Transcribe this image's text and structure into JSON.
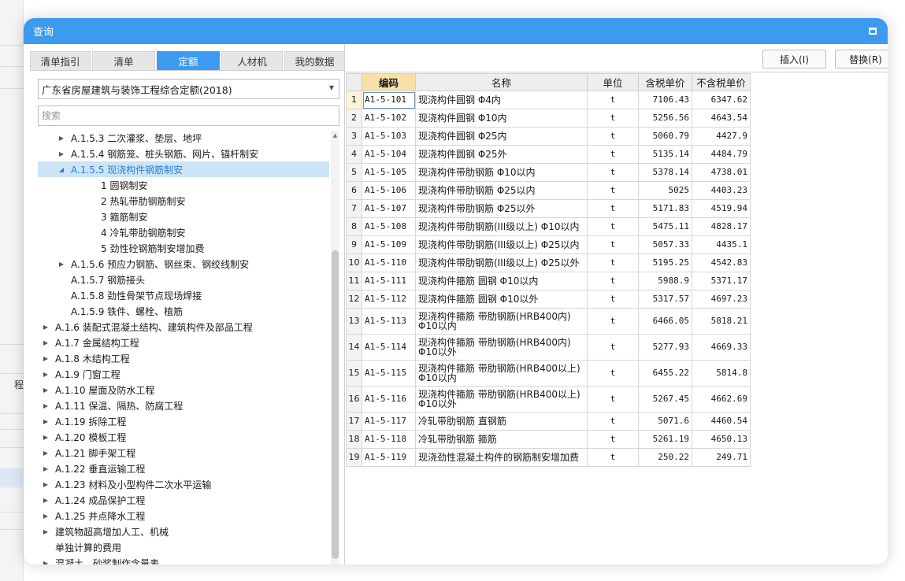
{
  "dialog": {
    "title": "查询"
  },
  "tabs": [
    {
      "label": "清单指引"
    },
    {
      "label": "清单"
    },
    {
      "label": "定额"
    },
    {
      "label": "人材机"
    },
    {
      "label": "我的数据"
    }
  ],
  "library": {
    "selected": "广东省房屋建筑与装饰工程综合定额(2018)"
  },
  "search": {
    "placeholder": "搜索"
  },
  "tree": [
    {
      "label": "A.1.5.3 二次灌浆、垫层、地坪",
      "arrow": "▶"
    },
    {
      "label": "A.1.5.4 钢筋笼、桩头钢筋、网片、锚杆制安",
      "arrow": "▶"
    },
    {
      "label": "A.1.5.5 现浇构件钢筋制安",
      "arrow": "◢",
      "selected": true
    },
    {
      "label": "1 圆钢制安",
      "arrow": ""
    },
    {
      "label": "2 热轧带肋钢筋制安",
      "arrow": ""
    },
    {
      "label": "3 箍筋制安",
      "arrow": ""
    },
    {
      "label": "4 冷轧带肋钢筋制安",
      "arrow": ""
    },
    {
      "label": "5 劲性砼钢筋制安增加费",
      "arrow": ""
    },
    {
      "label": "A.1.5.6 预应力钢筋、钢丝束、钢绞线制安",
      "arrow": "▶"
    },
    {
      "label": "A.1.5.7 钢筋接头",
      "arrow": ""
    },
    {
      "label": "A.1.5.8 劲性骨架节点现场焊接",
      "arrow": ""
    },
    {
      "label": "A.1.5.9 铁件、螺栓、植筋",
      "arrow": ""
    },
    {
      "label": "A.1.6 装配式混凝土结构、建筑构件及部品工程",
      "arrow": "▶"
    },
    {
      "label": "A.1.7 金属结构工程",
      "arrow": "▶"
    },
    {
      "label": "A.1.8 木结构工程",
      "arrow": "▶"
    },
    {
      "label": "A.1.9 门窗工程",
      "arrow": "▶"
    },
    {
      "label": "A.1.10 屋面及防水工程",
      "arrow": "▶"
    },
    {
      "label": "A.1.11 保温、隔热、防腐工程",
      "arrow": "▶"
    },
    {
      "label": "A.1.19 拆除工程",
      "arrow": "▶"
    },
    {
      "label": "A.1.20 模板工程",
      "arrow": "▶"
    },
    {
      "label": "A.1.21 脚手架工程",
      "arrow": "▶"
    },
    {
      "label": "A.1.22 垂直运输工程",
      "arrow": "▶"
    },
    {
      "label": "A.1.23 材料及小型构件二次水平运输",
      "arrow": "▶"
    },
    {
      "label": "A.1.24 成品保护工程",
      "arrow": "▶"
    },
    {
      "label": "A.1.25 井点降水工程",
      "arrow": "▶"
    },
    {
      "label": "建筑物超高增加人工、机械",
      "arrow": "▶"
    },
    {
      "label": "单独计算的费用",
      "arrow": ""
    },
    {
      "label": "混凝土、砂浆制作含量表",
      "arrow": "▶"
    }
  ],
  "toolbar": {
    "insert_label": "插入(I)",
    "replace_label": "替换(R)"
  },
  "grid": {
    "columns": [
      "编码",
      "名称",
      "单位",
      "含税单价",
      "不含税单价"
    ],
    "rows": [
      {
        "no": "1",
        "code": "A1-5-101",
        "name": "现浇构件圆钢 Φ4内",
        "unit": "t",
        "tax_price": "7106.43",
        "notax_price": "6347.62"
      },
      {
        "no": "2",
        "code": "A1-5-102",
        "name": "现浇构件圆钢 Φ10内",
        "unit": "t",
        "tax_price": "5256.56",
        "notax_price": "4643.54"
      },
      {
        "no": "3",
        "code": "A1-5-103",
        "name": "现浇构件圆钢 Φ25内",
        "unit": "t",
        "tax_price": "5060.79",
        "notax_price": "4427.9"
      },
      {
        "no": "4",
        "code": "A1-5-104",
        "name": "现浇构件圆钢 Φ25外",
        "unit": "t",
        "tax_price": "5135.14",
        "notax_price": "4484.79"
      },
      {
        "no": "5",
        "code": "A1-5-105",
        "name": "现浇构件带肋钢筋 Φ10以内",
        "unit": "t",
        "tax_price": "5378.14",
        "notax_price": "4738.01"
      },
      {
        "no": "6",
        "code": "A1-5-106",
        "name": "现浇构件带肋钢筋 Φ25以内",
        "unit": "t",
        "tax_price": "5025",
        "notax_price": "4403.23"
      },
      {
        "no": "7",
        "code": "A1-5-107",
        "name": "现浇构件带肋钢筋 Φ25以外",
        "unit": "t",
        "tax_price": "5171.83",
        "notax_price": "4519.94"
      },
      {
        "no": "8",
        "code": "A1-5-108",
        "name": "现浇构件带肋钢筋(III级以上) Φ10以内",
        "unit": "t",
        "tax_price": "5475.11",
        "notax_price": "4828.17"
      },
      {
        "no": "9",
        "code": "A1-5-109",
        "name": "现浇构件带肋钢筋(III级以上) Φ25以内",
        "unit": "t",
        "tax_price": "5057.33",
        "notax_price": "4435.1"
      },
      {
        "no": "10",
        "code": "A1-5-110",
        "name": "现浇构件带肋钢筋(III级以上) Φ25以外",
        "unit": "t",
        "tax_price": "5195.25",
        "notax_price": "4542.83"
      },
      {
        "no": "11",
        "code": "A1-5-111",
        "name": "现浇构件箍筋 圆钢 Φ10以内",
        "unit": "t",
        "tax_price": "5988.9",
        "notax_price": "5371.17"
      },
      {
        "no": "12",
        "code": "A1-5-112",
        "name": "现浇构件箍筋 圆钢 Φ10以外",
        "unit": "t",
        "tax_price": "5317.57",
        "notax_price": "4697.23"
      },
      {
        "no": "13",
        "code": "A1-5-113",
        "name": "现浇构件箍筋 带肋钢筋(HRB400内) Φ10以内",
        "unit": "t",
        "tax_price": "6466.05",
        "notax_price": "5818.21",
        "tall": true
      },
      {
        "no": "14",
        "code": "A1-5-114",
        "name": "现浇构件箍筋 带肋钢筋(HRB400内) Φ10以外",
        "unit": "t",
        "tax_price": "5277.93",
        "notax_price": "4669.33",
        "tall": true
      },
      {
        "no": "15",
        "code": "A1-5-115",
        "name": "现浇构件箍筋 带肋钢筋(HRB400以上) Φ10以内",
        "unit": "t",
        "tax_price": "6455.22",
        "notax_price": "5814.8",
        "tall": true
      },
      {
        "no": "16",
        "code": "A1-5-116",
        "name": "现浇构件箍筋 带肋钢筋(HRB400以上) Φ10以外",
        "unit": "t",
        "tax_price": "5267.45",
        "notax_price": "4662.69",
        "tall": true
      },
      {
        "no": "17",
        "code": "A1-5-117",
        "name": "冷轧带肋钢筋 直钢筋",
        "unit": "t",
        "tax_price": "5071.6",
        "notax_price": "4460.54"
      },
      {
        "no": "18",
        "code": "A1-5-118",
        "name": "冷轧带肋钢筋 箍筋",
        "unit": "t",
        "tax_price": "5261.19",
        "notax_price": "4650.13"
      },
      {
        "no": "19",
        "code": "A1-5-119",
        "name": "现浇劲性混凝土构件的钢筋制安增加费",
        "unit": "t",
        "tax_price": "250.22",
        "notax_price": "249.71"
      }
    ]
  },
  "background": {
    "sidebar_char": "程"
  },
  "colors": {
    "accent": "#3c9aef",
    "header_highlight": "#f8e1a8",
    "tree_selected": "#cde4f7"
  }
}
